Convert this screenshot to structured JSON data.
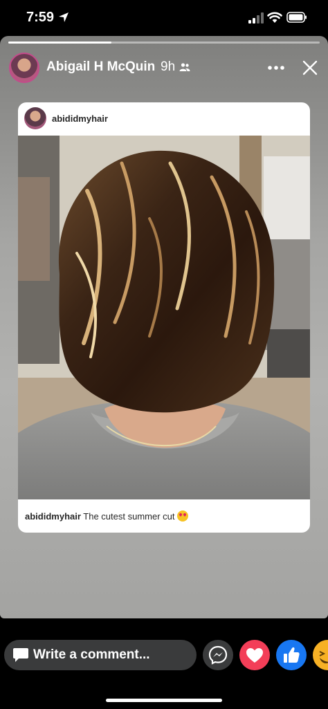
{
  "status_bar": {
    "time": "7:59",
    "icons": [
      "location-arrow-icon",
      "signal-icon",
      "wifi-icon",
      "battery-icon"
    ]
  },
  "story": {
    "progress": 0.33,
    "author_name": "Abigail H McQuin",
    "time_ago": "9h",
    "audience_icon": "friends-icon",
    "more_icon": "more-dots-icon",
    "close_icon": "close-icon"
  },
  "post": {
    "username": "abididmyhair",
    "caption_username": "abididmyhair",
    "caption_text": " The cutest summer cut",
    "emoji": "heart-eyes-emoji",
    "photo_subject": "short-layered-bob-haircut-photo"
  },
  "reply_bar": {
    "comment_placeholder": "Write a comment...",
    "reactions": [
      "messenger-icon",
      "love-icon",
      "like-icon",
      "haha-icon"
    ]
  },
  "colors": {
    "like_blue": "#1877f2",
    "love_red": "#f33e58",
    "haha_yellow": "#f7b125",
    "input_gray": "#3a3b3c"
  }
}
